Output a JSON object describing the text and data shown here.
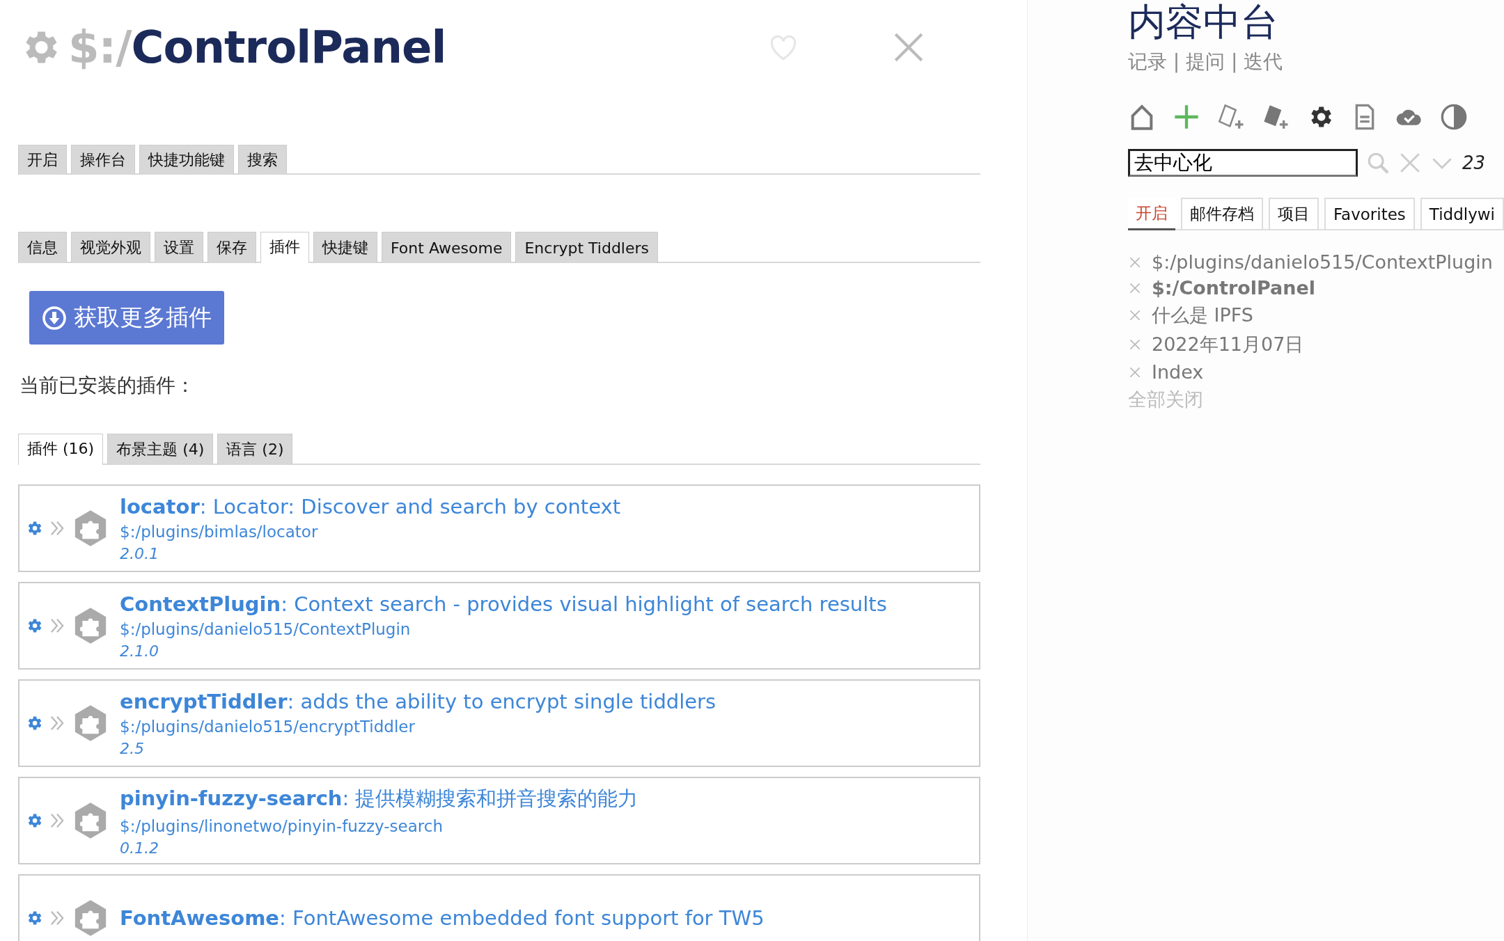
{
  "tiddler": {
    "title_prefix": "$:/",
    "title": "ControlPanel"
  },
  "main_tabs": [
    {
      "label": "开启",
      "selected": false
    },
    {
      "label": "操作台",
      "selected": false
    },
    {
      "label": "快捷功能键",
      "selected": false
    },
    {
      "label": "搜索",
      "selected": false
    }
  ],
  "section_tabs": [
    {
      "label": "信息",
      "selected": false
    },
    {
      "label": "视觉外观",
      "selected": false
    },
    {
      "label": "设置",
      "selected": false
    },
    {
      "label": "保存",
      "selected": false
    },
    {
      "label": "插件",
      "selected": true
    },
    {
      "label": "快捷键",
      "selected": false
    },
    {
      "label": "Font Awesome",
      "selected": false
    },
    {
      "label": "Encrypt Tiddlers",
      "selected": false
    }
  ],
  "get_more_button": "获取更多插件",
  "installed_label": "当前已安装的插件：",
  "plugin_tabs": [
    {
      "label": "插件 (16)",
      "selected": true
    },
    {
      "label": "布景主题 (4)",
      "selected": false
    },
    {
      "label": "语言 (2)",
      "selected": false
    }
  ],
  "plugins": [
    {
      "name": "locator",
      "description": ": Locator: Discover and search by context",
      "path": "$:/plugins/bimlas/locator",
      "version": "2.0.1"
    },
    {
      "name": "ContextPlugin",
      "description": ": Context search - provides visual highlight of search results",
      "path": "$:/plugins/danielo515/ContextPlugin",
      "version": "2.1.0"
    },
    {
      "name": "encryptTiddler",
      "description": ": adds the ability to encrypt single tiddlers",
      "path": "$:/plugins/danielo515/encryptTiddler",
      "version": "2.5"
    },
    {
      "name": "pinyin-fuzzy-search",
      "description": ": 提供模糊搜索和拼音搜索的能力",
      "path": "$:/plugins/linonetwo/pinyin-fuzzy-search",
      "version": "0.1.2"
    },
    {
      "name": "FontAwesome",
      "description": ": FontAwesome embedded font support for TW5"
    }
  ],
  "sidebar": {
    "site_title": "内容中台",
    "subtitle": "记录 | 提问 | 迭代",
    "search": {
      "value": "去中心化",
      "result_count": "23"
    },
    "tabs": [
      {
        "label": "开启",
        "selected": true
      },
      {
        "label": "邮件存档",
        "selected": false
      },
      {
        "label": "项目",
        "selected": false
      },
      {
        "label": "Favorites",
        "selected": false
      },
      {
        "label": "Tiddlywi",
        "selected": false
      }
    ],
    "open_tiddlers": [
      {
        "title": "$:/plugins/danielo515/ContextPlugin",
        "current": false
      },
      {
        "title": "$:/ControlPanel",
        "current": true
      },
      {
        "title": "什么是 IPFS",
        "current": false
      },
      {
        "title": "2022年11月07日",
        "current": false
      },
      {
        "title": "Index",
        "current": false
      }
    ],
    "close_all": "全部关闭"
  }
}
